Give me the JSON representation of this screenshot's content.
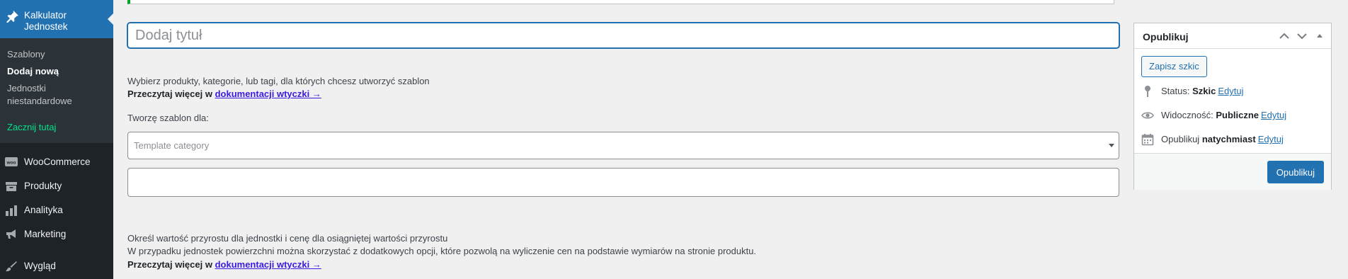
{
  "sidebar": {
    "active_item": "Kalkulator Jednostek",
    "submenu": [
      "Szablony",
      "Dodaj nową",
      "Jednostki niestandardowe",
      "Zacznij tutaj"
    ],
    "items": [
      "WooCommerce",
      "Produkty",
      "Analityka",
      "Marketing",
      "Wygląd"
    ],
    "woo_badge": "woo"
  },
  "editor": {
    "title_placeholder": "Dodaj tytuł",
    "intro_text": "Wybierz produkty, kategorie, lub tagi, dla których chcesz utworzyć szablon",
    "read_more_prefix": "Przeczytaj więcej w",
    "read_more_link": "dokumentacji wtyczki →",
    "template_for_label": "Tworzę szablon dla:",
    "select_placeholder": "Template category",
    "step_text_1": "Określ wartość przyrostu dla jednostki i cenę dla osiągniętej wartości przyrostu",
    "step_text_2": "W przypadku jednostek powierzchni można skorzystać z dodatkowych opcji, które pozwolą na wyliczenie cen na podstawie wymiarów na stronie produktu.",
    "read_more_prefix_2": "Przeczytaj więcej w",
    "read_more_link_2": "dokumentacji wtyczki →"
  },
  "publish_box": {
    "title": "Opublikuj",
    "save_draft": "Zapisz szkic",
    "status_label": "Status:",
    "status_value": "Szkic",
    "visibility_label": "Widoczność:",
    "visibility_value": "Publiczne",
    "publish_label": "Opublikuj",
    "publish_value": "natychmiast",
    "edit": "Edytuj",
    "publish_button": "Opublikuj"
  }
}
